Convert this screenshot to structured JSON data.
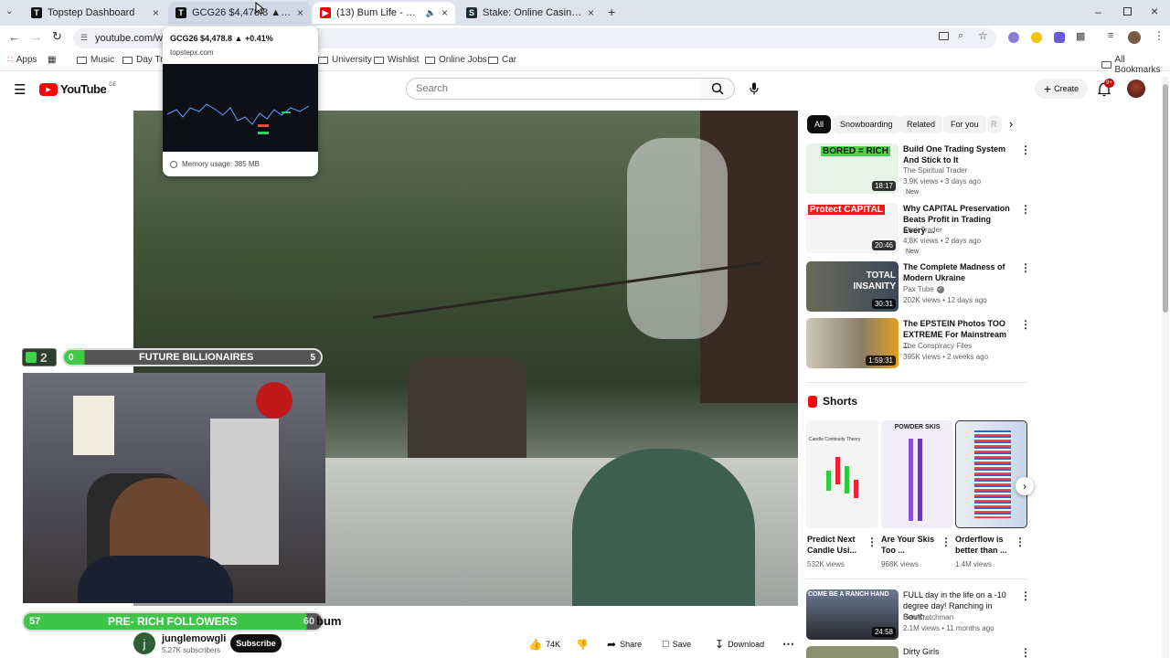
{
  "browser": {
    "tabs": [
      {
        "title": "Topstep Dashboard",
        "favicon": "T"
      },
      {
        "title": "GCG26 $4,478.8 ▲ +0.41%",
        "favicon": "T"
      },
      {
        "title": "(13) Bum Life - Charley Ager",
        "favicon": "▶"
      },
      {
        "title": "Stake: Online Casino & Sportsbook",
        "favicon": "S"
      }
    ],
    "url": "youtube.com/wat",
    "bookmarks": [
      "Apps",
      "Music",
      "Day Trad",
      "University",
      "Wishlist",
      "Online Jobs",
      "Car"
    ],
    "all_bookmarks": "All Bookmarks"
  },
  "tooltip": {
    "title": "GCG26 $4,478.8 ▲ +0.41%",
    "domain": "topstepx.com",
    "memory": "Memory usage: 385 MB"
  },
  "youtube": {
    "logo": "YouTube",
    "region": "DE",
    "search_placeholder": "Search",
    "create_label": "Create",
    "notif_count": "9+"
  },
  "chips": [
    "All",
    "Snowboarding",
    "Related",
    "For you",
    "R"
  ],
  "recommendations": [
    {
      "title": "Build One Trading System And Stick to It",
      "channel": "The Spiritual Trader",
      "meta": "3.9K views • 3 days ago",
      "badge": "New",
      "duration": "18:17",
      "thumb_text": "BORED = RICH",
      "color": "#e8f2e8"
    },
    {
      "title": "Why CAPITAL Preservation Beats Profit in Trading Every ...",
      "channel": "Stick Trader",
      "meta": "4.8K views • 2 days ago",
      "badge": "New",
      "duration": "20:46",
      "thumb_text": "Protect CAPITAL",
      "color": "#f2f2f2"
    },
    {
      "title": "The Complete Madness of Modern Ukraine",
      "channel": "Pax Tube",
      "meta": "202K views • 12 days ago",
      "badge": "",
      "duration": "30:31",
      "thumb_text": "TOTAL INSANITY",
      "color": "#4a5a6a"
    },
    {
      "title": "The EPSTEIN Photos TOO EXTREME For Mainstream ...",
      "channel": "The Conspiracy Files",
      "meta": "395K views • 2 weeks ago",
      "badge": "",
      "duration": "1:59:31",
      "thumb_text": "",
      "color": "#8a7c6a"
    }
  ],
  "shorts_heading": "Shorts",
  "shorts": [
    {
      "title": "Predict Next Candle Usi...",
      "views": "532K views",
      "thumb_text": "Candle Continuity Theory"
    },
    {
      "title": "Are Your Skis Too ...",
      "views": "968K views",
      "thumb_text": "POWDER SKIS"
    },
    {
      "title": "Orderflow is better than ...",
      "views": "1.4M views",
      "thumb_text": ""
    }
  ],
  "more_videos": [
    {
      "title": "FULL day in the life on a -10 degree day! Ranching in South...",
      "channel": "Ben Kretchman",
      "meta": "2.1M views • 11 months ago",
      "duration": "24:58",
      "thumb_text": "COME BE A RANCH HAND"
    },
    {
      "title": "Dirty Girls"
    }
  ],
  "stream_overlay": {
    "top_counter_left": "2",
    "top_count": "0",
    "top_label": "FUTURE BILLIONAIRES",
    "top_count_right": "5",
    "bottom_count": "57",
    "bottom_label": "PRE- RICH FOLLOWERS",
    "bottom_count_right": "60"
  },
  "video": {
    "title_fragment": "bum",
    "channel": "junglemowgli",
    "channel_initial": "j",
    "subscribers": "5.27K subscribers",
    "subscribe": "Subscribe",
    "likes": "74K",
    "share": "Share",
    "save": "Save",
    "download": "Download"
  }
}
